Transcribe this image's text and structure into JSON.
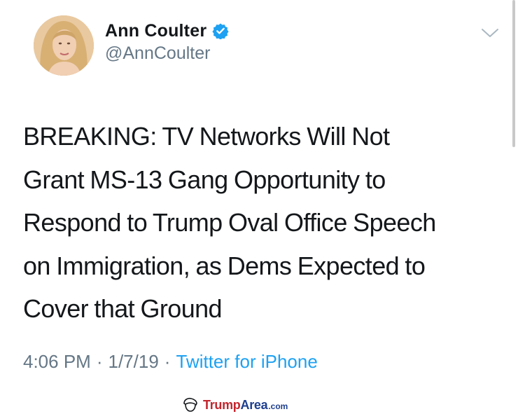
{
  "tweet": {
    "display_name": "Ann Coulter",
    "handle": "@AnnCoulter",
    "verified_icon": "verified-badge-icon",
    "menu_icon": "chevron-down-icon",
    "lines": [
      "BREAKING: TV Networks Will Not",
      "Grant MS-13 Gang Opportunity to",
      "Respond to Trump Oval Office Speech",
      "on Immigration, as Dems Expected to",
      "Cover that Ground"
    ],
    "time": "4:06 PM",
    "separator": "·",
    "date": "1/7/19",
    "source": "Twitter for iPhone"
  },
  "watermark": {
    "brand_part1": "Trump",
    "brand_part2": "Area",
    "tld": ".com"
  },
  "colors": {
    "text": "#14171a",
    "secondary": "#657786",
    "link": "#1da1f2",
    "verified": "#1da1f2",
    "watermark_red": "#c4262e",
    "watermark_blue": "#1e3f8f"
  }
}
